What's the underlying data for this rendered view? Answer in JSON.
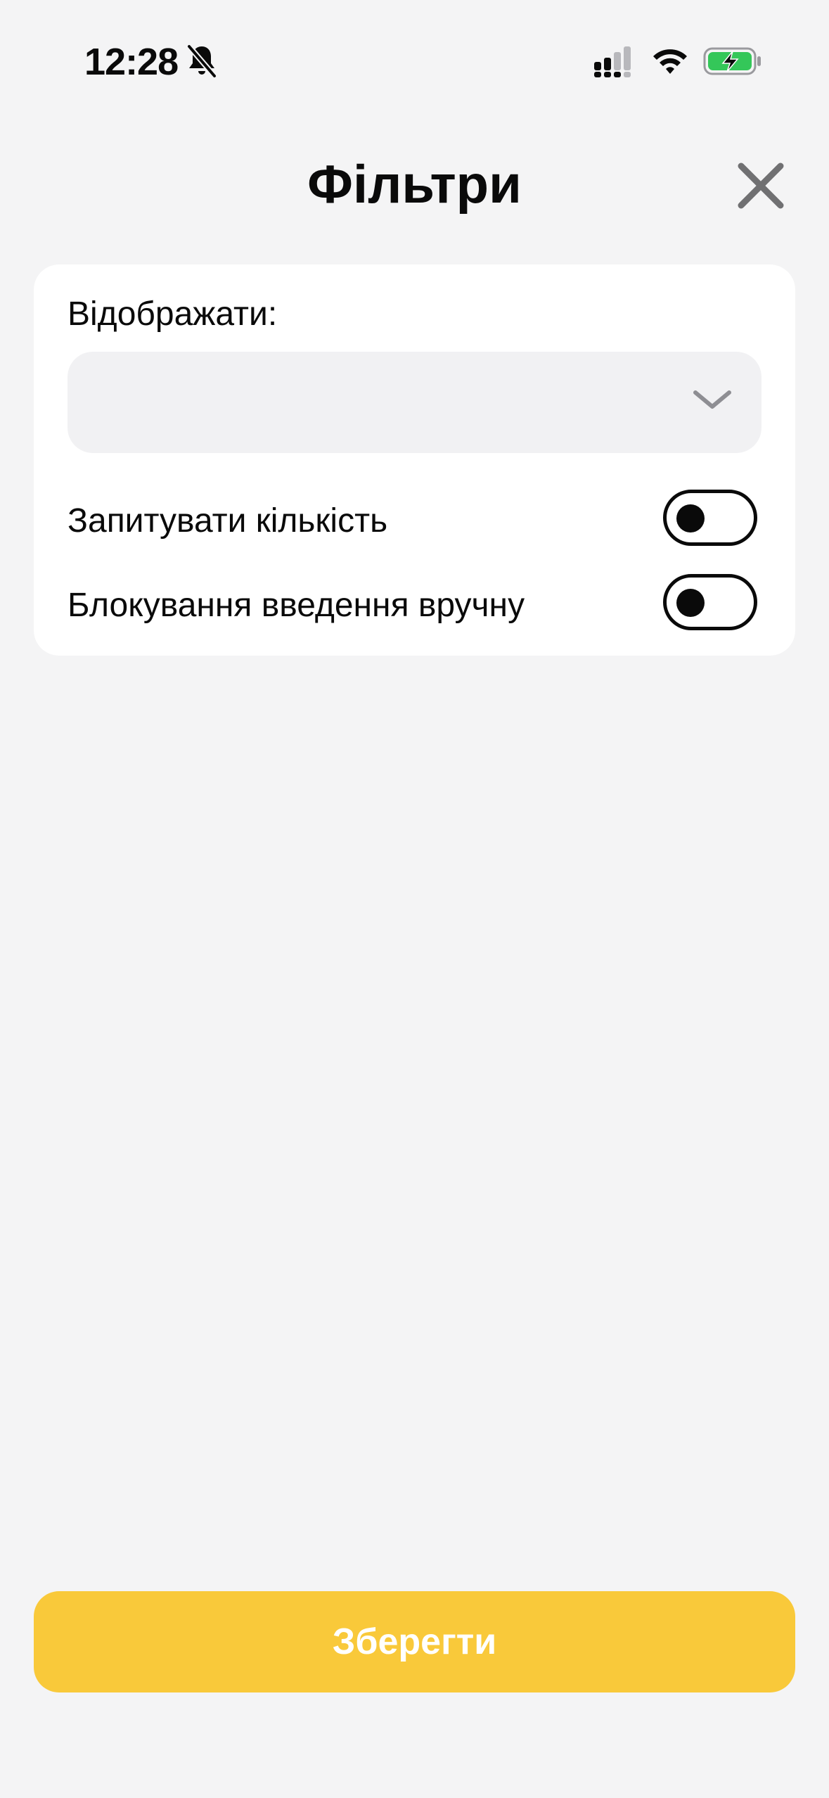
{
  "status_bar": {
    "time": "12:28",
    "icons": [
      "bell-slash-icon",
      "signal-icon",
      "wifi-icon",
      "battery-charging-icon"
    ],
    "battery_color": "#34c759"
  },
  "header": {
    "title": "Фільтри",
    "close_icon": "close-icon"
  },
  "filters": {
    "display_label": "Відображати:",
    "display_select": {
      "value": "",
      "icon": "chevron-down-icon"
    },
    "toggles": [
      {
        "label": "Запитувати кількість",
        "on": false
      },
      {
        "label": "Блокування введення вручну",
        "on": false
      }
    ]
  },
  "footer": {
    "save_label": "Зберегти",
    "accent_color": "#f9c93a"
  }
}
